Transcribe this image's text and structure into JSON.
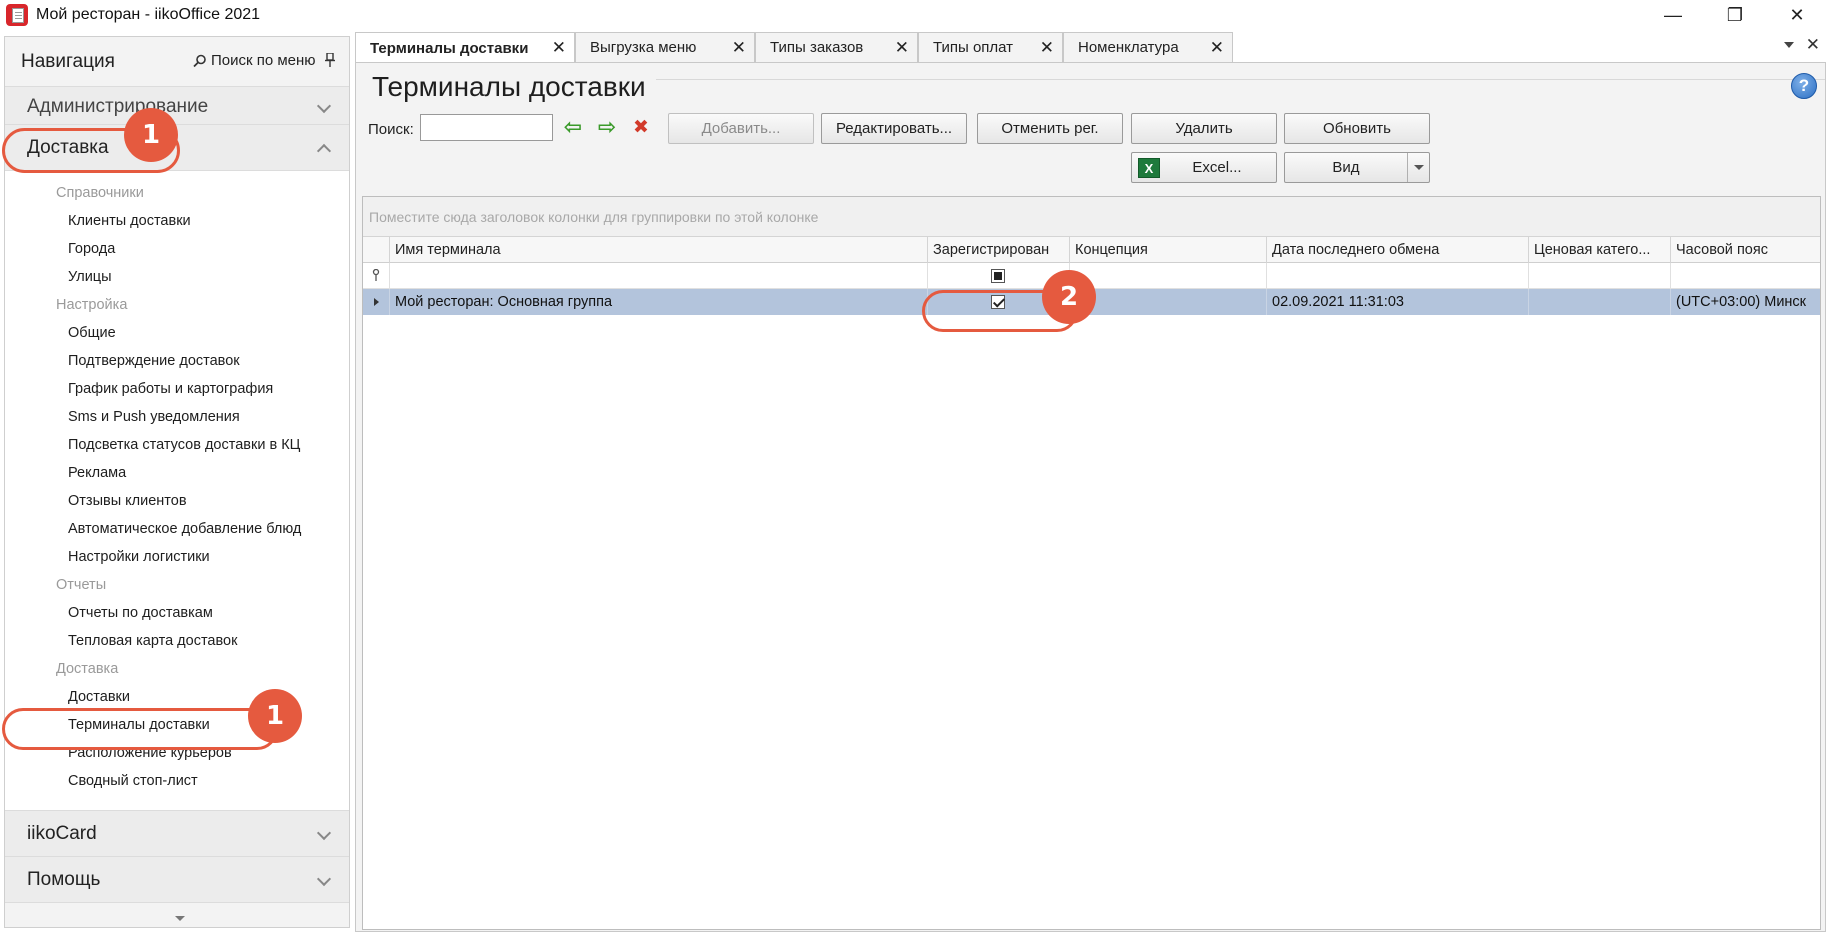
{
  "window": {
    "title": "Мой ресторан - iikoOffice 2021",
    "minimize": "—",
    "restore": "❐",
    "close": "✕"
  },
  "nav": {
    "title": "Навигация",
    "search": "Поиск по меню",
    "sections": {
      "admin": "Администрирование",
      "delivery": "Доставка",
      "iikocard": "iikoCard",
      "help": "Помощь"
    },
    "groups": [
      {
        "label": "Справочники",
        "items": [
          "Клиенты доставки",
          "Города",
          "Улицы"
        ]
      },
      {
        "label": "Настройка",
        "items": [
          "Общие",
          "Подтверждение доставок",
          "График работы и картография",
          "Sms и Push уведомления",
          "Подсветка статусов доставки в КЦ",
          "Реклама",
          "Отзывы клиентов",
          "Автоматическое добавление блюд",
          "Настройки логистики"
        ]
      },
      {
        "label": "Отчеты",
        "items": [
          "Отчеты по доставкам",
          "Тепловая карта доставок"
        ]
      },
      {
        "label": "Доставка",
        "items": [
          "Доставки",
          "Терминалы доставки",
          "Расположение курьеров",
          "Сводный стоп-лист"
        ]
      }
    ]
  },
  "callouts": [
    "1",
    "1",
    "2"
  ],
  "tabs": [
    {
      "label": "Терминалы доставки",
      "active": true
    },
    {
      "label": "Выгрузка меню"
    },
    {
      "label": "Типы заказов"
    },
    {
      "label": "Типы оплат"
    },
    {
      "label": "Номенклатура"
    }
  ],
  "page": {
    "title": "Терминалы доставки",
    "help": "?",
    "search_label": "Поиск:",
    "search_value": "",
    "buttons": {
      "add": "Добавить...",
      "edit": "Редактировать...",
      "unregister": "Отменить рег.",
      "delete": "Удалить",
      "refresh": "Обновить",
      "excel": "Excel...",
      "view": "Вид"
    },
    "arrows": {
      "back": "⇦",
      "forward": "⇨",
      "clear": "✖"
    },
    "colors": {
      "back": "#3a9a2a",
      "forward": "#3a9a2a",
      "clear": "#d23a2a",
      "selected_row": "#b3c4dc",
      "callout": "#e55a3f"
    }
  },
  "grid": {
    "group_hint": "Поместите сюда заголовок колонки для группировки по этой колонке",
    "columns": [
      "Имя терминала",
      "Зарегистрирован",
      "Концепция",
      "Дата последнего обмена",
      "Ценовая катего...",
      "Часовой пояс"
    ],
    "rows": [
      {
        "name": "Мой ресторан: Основная группа",
        "registered": true,
        "concept": "",
        "last_exchange": "02.09.2021 11:31:03",
        "price_category": "",
        "timezone": "(UTC+03:00) Минск"
      }
    ]
  }
}
